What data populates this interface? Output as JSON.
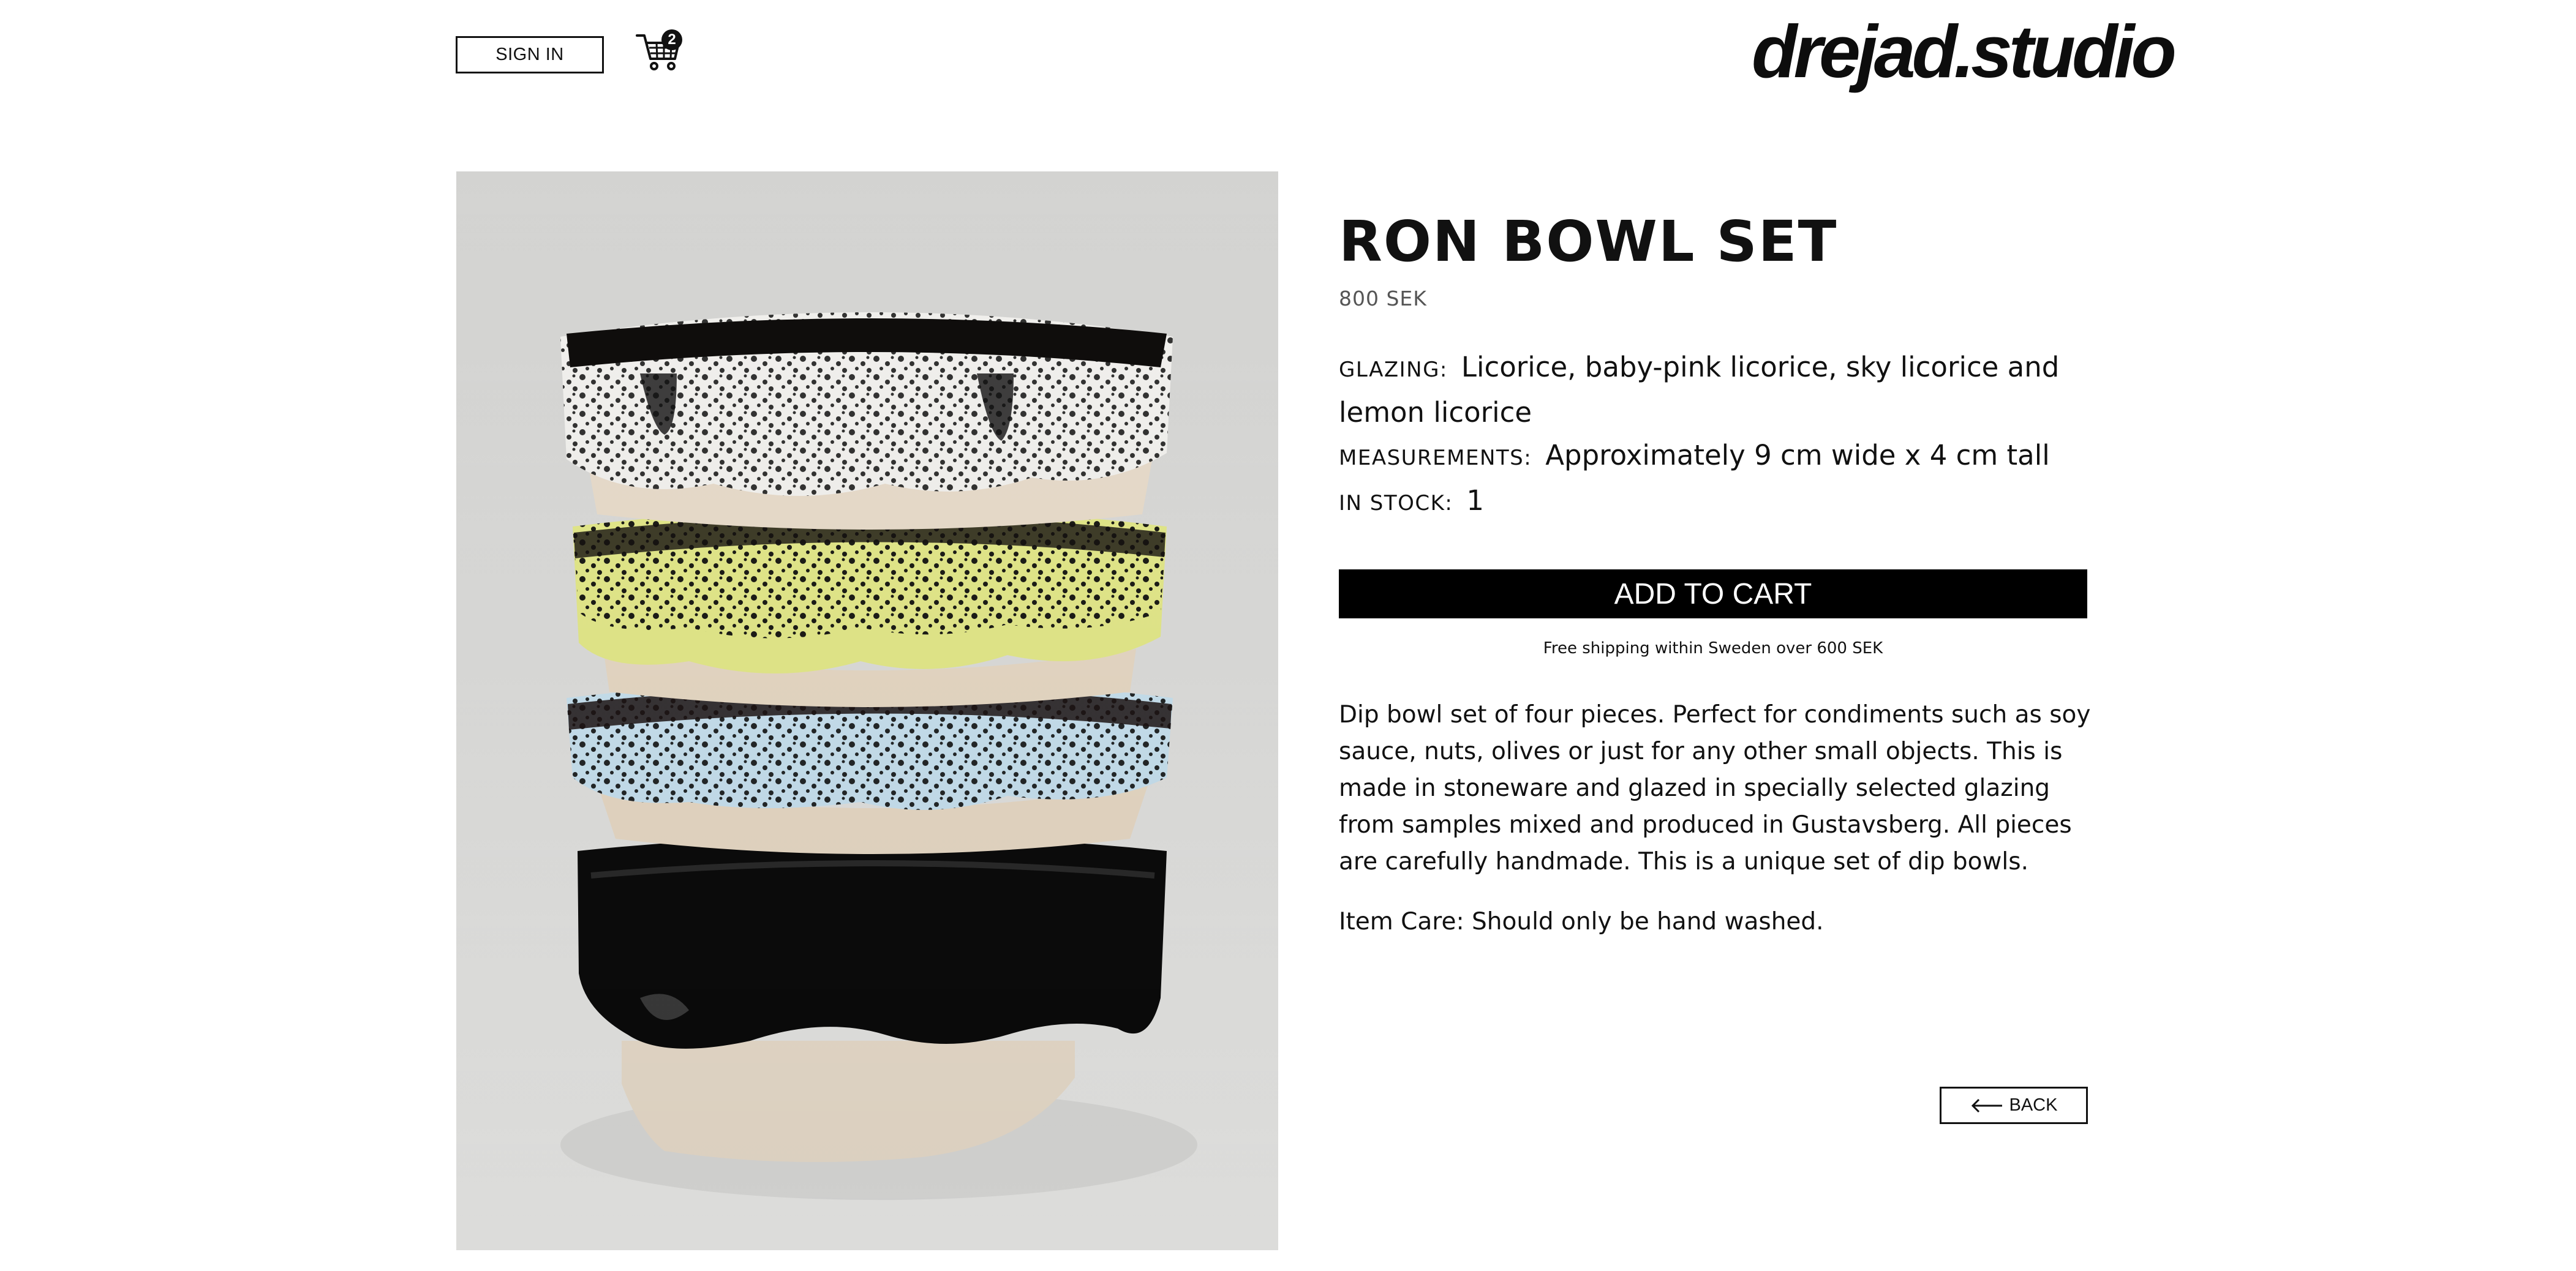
{
  "header": {
    "sign_in_label": "SIGN IN",
    "cart_count": "2",
    "logo_text": "drejad.studio"
  },
  "product": {
    "title": "RON BOWL SET",
    "price": "800 SEK",
    "glazing_label": "GLAZING:",
    "glazing_value": "Licorice, baby-pink licorice, sky licorice and lemon licorice",
    "measurements_label": "MEASUREMENTS:",
    "measurements_value": "Approximately 9 cm wide x 4 cm tall",
    "stock_label": "IN STOCK:",
    "stock_value": "1",
    "add_to_cart_label": "ADD TO CART",
    "shipping_note": "Free shipping within Sweden over 600 SEK",
    "description": "Dip bowl set of four pieces. Perfect for condiments such as soy sauce, nuts, olives or just for any other small objects. This is made in stoneware and glazed in specially selected glazing from samples mixed and produced in Gustavsberg. All pieces are carefully handmade. This is a unique set of dip bowls.",
    "care": "Item Care: Should only be hand washed.",
    "back_label": "BACK"
  },
  "colors": {
    "accent": "#000000",
    "background": "#ffffff",
    "price_text": "#555555"
  },
  "icons": {
    "cart": "cart-icon",
    "back": "arrow-left-icon"
  }
}
